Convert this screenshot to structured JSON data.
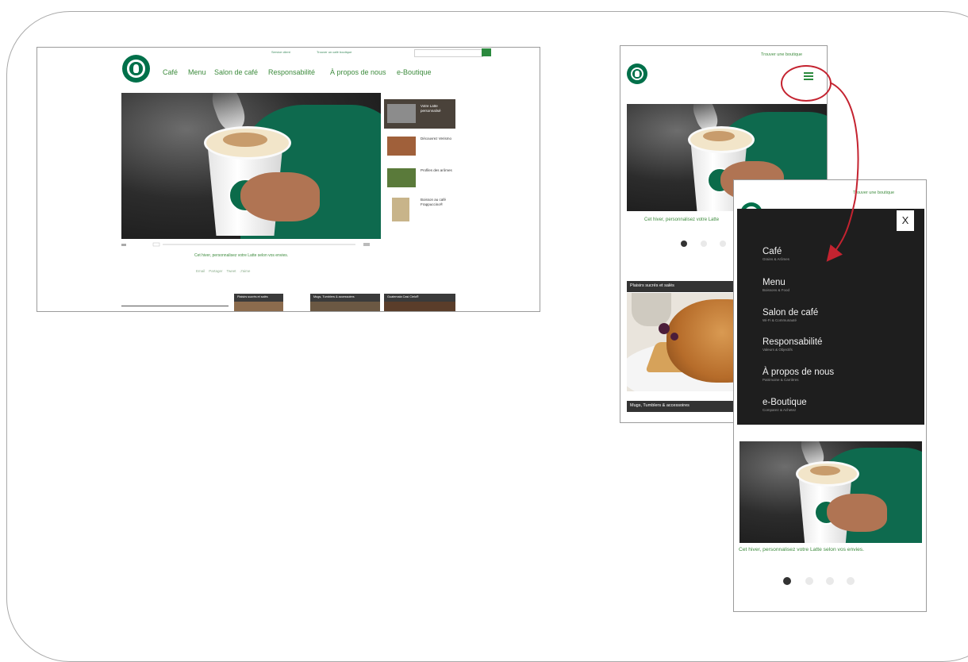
{
  "desktop": {
    "utility_links": [
      "Service client",
      "Trouver un café boutique"
    ],
    "nav": [
      "Café",
      "Menu",
      "Salon de café",
      "Responsabilité",
      "À propos de nous",
      "e-Boutique"
    ],
    "caption": "Cet hiver, personnalisez votre Latte selon vos envies.",
    "share_links": [
      "Email",
      "Partager",
      "Tweet",
      "J'aime"
    ],
    "side_items": [
      {
        "label": "Votre Latte personnalisé",
        "active": true
      },
      {
        "label": "Découvrez Verismo",
        "active": false
      },
      {
        "label": "Profiles des arômes",
        "active": false
      },
      {
        "label": "Boisson au café Frappuccino®",
        "active": false
      }
    ],
    "tiles": [
      "Plaisirs sucrés et salés",
      "Mugs, Tumblers & accessoires",
      "Guatemala Casi Cielo®"
    ]
  },
  "mobile_closed": {
    "store_link": "Trouver une boutique",
    "caption": "Cet hiver, personnalisez votre Latte",
    "strips": [
      "Plaisirs sucrés et salés",
      "Mugs, Tumblers & accessoires"
    ]
  },
  "mobile_open": {
    "store_link": "Trouver une boutique",
    "close_label": "X",
    "menu": [
      {
        "title": "Café",
        "sub": "Grains & Arômes"
      },
      {
        "title": "Menu",
        "sub": "Boissons & Food"
      },
      {
        "title": "Salon de café",
        "sub": "Wi-Fi & Communauté"
      },
      {
        "title": "Responsabilité",
        "sub": "Valeurs & Objectifs"
      },
      {
        "title": "À propos de nous",
        "sub": "Patrimoine & Carrières"
      },
      {
        "title": "e-Boutique",
        "sub": "Comparez & Achetez"
      }
    ],
    "caption": "Cet hiver, personnalisez votre Latte selon vos envies."
  },
  "colors": {
    "brand_green": "#00704a",
    "link_green": "#3d8b3d",
    "annotation_red": "#c42330",
    "menu_bg": "#1e1e1e"
  }
}
